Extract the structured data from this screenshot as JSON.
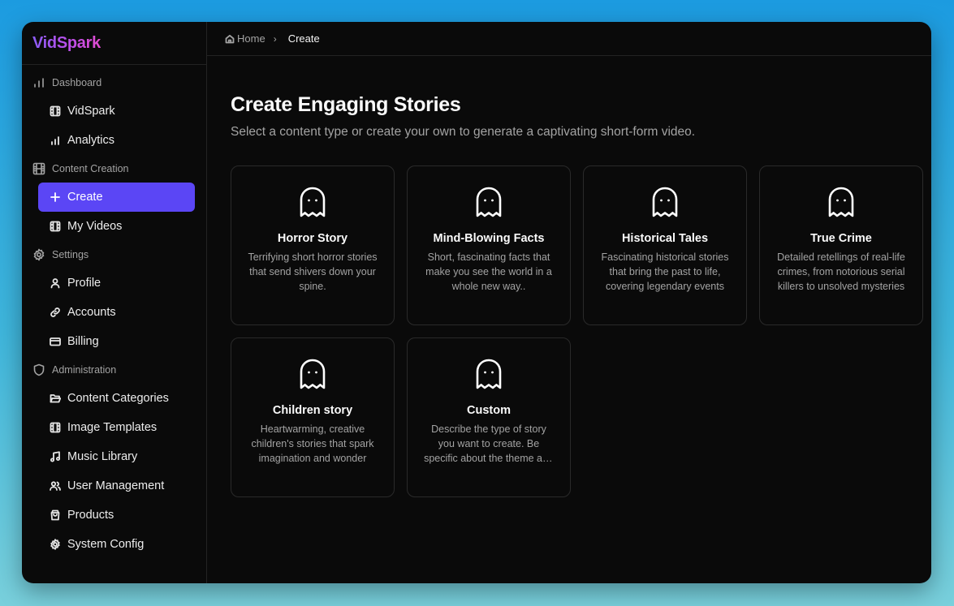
{
  "brand": "VidSpark",
  "breadcrumb": {
    "home": "Home",
    "separator": "›",
    "current": "Create"
  },
  "sidebar": {
    "groups": [
      {
        "label": "Dashboard",
        "icon": "bar-chart-icon",
        "items": [
          {
            "label": "VidSpark",
            "icon": "film-icon"
          },
          {
            "label": "Analytics",
            "icon": "bar-chart-icon"
          }
        ]
      },
      {
        "label": "Content Creation",
        "icon": "film-icon",
        "items": [
          {
            "label": "Create",
            "icon": "plus-icon",
            "active": true
          },
          {
            "label": "My Videos",
            "icon": "film-icon"
          }
        ]
      },
      {
        "label": "Settings",
        "icon": "gear-icon",
        "items": [
          {
            "label": "Profile",
            "icon": "user-icon"
          },
          {
            "label": "Accounts",
            "icon": "link-icon"
          },
          {
            "label": "Billing",
            "icon": "credit-card-icon"
          }
        ]
      },
      {
        "label": "Administration",
        "icon": "shield-icon",
        "items": [
          {
            "label": "Content Categories",
            "icon": "folder-open-icon"
          },
          {
            "label": "Image Templates",
            "icon": "film-icon"
          },
          {
            "label": "Music Library",
            "icon": "music-icon"
          },
          {
            "label": "User Management",
            "icon": "users-icon"
          },
          {
            "label": "Products",
            "icon": "shopping-bag-icon"
          },
          {
            "label": "System Config",
            "icon": "gear-icon"
          }
        ]
      }
    ]
  },
  "main": {
    "title": "Create Engaging Stories",
    "subtitle": "Select a content type or create your own to generate a captivating short-form video.",
    "cards": [
      {
        "title": "Horror Story",
        "description": "Terrifying short horror stories that send shivers down your spine.",
        "icon": "ghost-icon"
      },
      {
        "title": "Mind-Blowing Facts",
        "description": "Short, fascinating facts that make you see the world in a whole new way..",
        "icon": "ghost-icon"
      },
      {
        "title": "Historical Tales",
        "description": "Fascinating historical stories that bring the past to life, covering legendary events",
        "icon": "ghost-icon"
      },
      {
        "title": "True Crime",
        "description": "Detailed retellings of real-life crimes, from notorious serial killers to unsolved mysteries",
        "icon": "ghost-icon"
      },
      {
        "title": "Children story",
        "description": "Heartwarming, creative children's stories that spark imagination and wonder",
        "icon": "ghost-icon"
      },
      {
        "title": "Custom",
        "description": "Describe the type of story you want to create. Be specific about the theme and tone",
        "icon": "ghost-icon"
      }
    ]
  },
  "colors": {
    "accent": "#5b46f5",
    "background": "#0a0a0a",
    "border": "#2a2a2a"
  }
}
